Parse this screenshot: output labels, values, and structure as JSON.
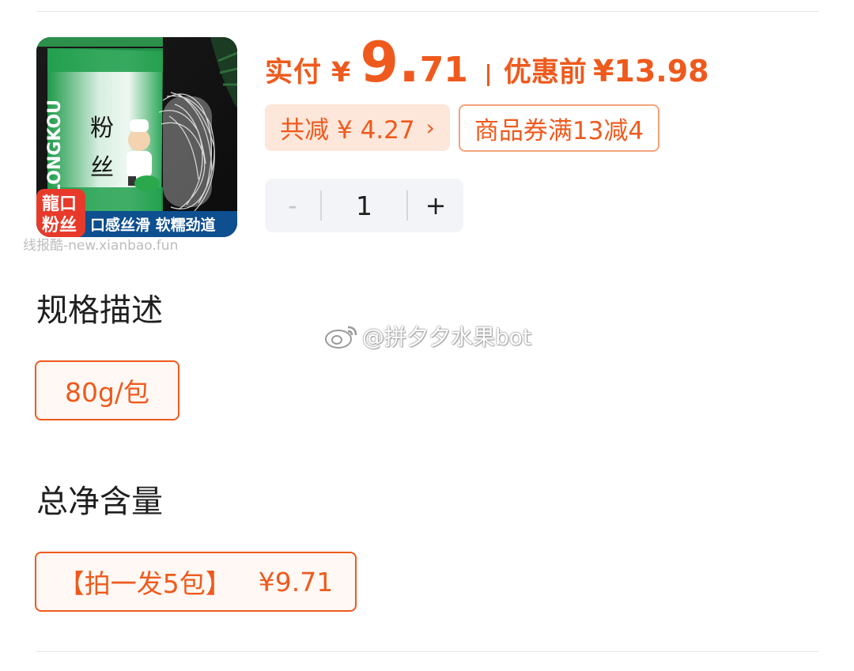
{
  "product": {
    "image_tag": "龍口粉丝",
    "image_banner": "口感丝滑 软糯劲道",
    "image_pack_text": "粉 丝",
    "image_side_text": "LONGKOU",
    "image_watermark": "线报酷-new.xianbao.fun"
  },
  "price": {
    "pay_label": "实付",
    "currency": "¥",
    "int_part": "9",
    "dot": ".",
    "decimal_part": "71",
    "before_label": "优惠前",
    "before_value": "¥13.98"
  },
  "discount": {
    "total_saving": "共减 ¥ 4.27",
    "coupon": "商品券满13减4"
  },
  "stepper": {
    "minus": "-",
    "quantity": "1",
    "plus": "+"
  },
  "spec": {
    "title": "规格描述",
    "option": "80g/包"
  },
  "net_content": {
    "title": "总净含量",
    "option_label": "【拍一发5包】",
    "option_price": "¥9.71"
  },
  "watermark": {
    "text": "@拼夕夕水果bot"
  },
  "colors": {
    "accent": "#ee5a1d",
    "chip_bg": "#fde6da",
    "stepper_bg": "#f2f4f7"
  }
}
